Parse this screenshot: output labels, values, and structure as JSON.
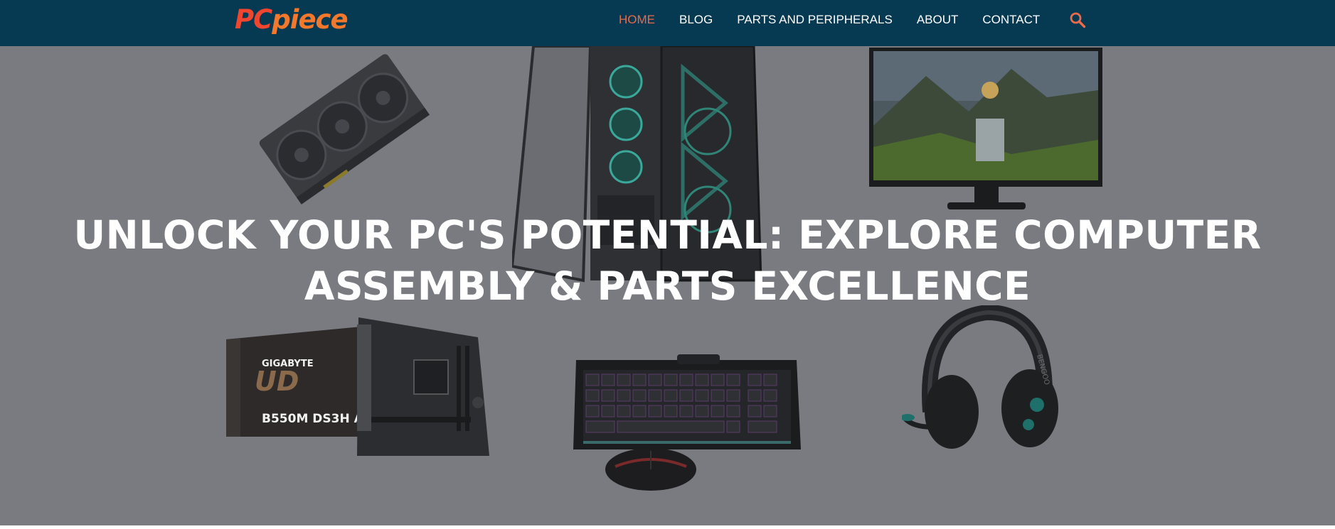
{
  "brand": {
    "logo_pc": "PC",
    "logo_piece": "piece",
    "logo_pc_color": "#f0452f",
    "logo_piece_color": "#f3782c"
  },
  "nav": {
    "items": [
      {
        "label": "HOME",
        "active": true
      },
      {
        "label": "BLOG",
        "active": false
      },
      {
        "label": "PARTS AND PERIPHERALS",
        "active": false
      },
      {
        "label": "ABOUT",
        "active": false
      },
      {
        "label": "CONTACT",
        "active": false
      }
    ],
    "search_icon": "search-icon",
    "background": "#063952",
    "active_color": "#ea6a4a"
  },
  "hero": {
    "title": "UNLOCK YOUR PC'S POTENTIAL: EXPLORE COMPUTER ASSEMBLY & PARTS EXCELLENCE",
    "overlay_color": "#7a7b80",
    "motherboard_brand": "GIGABYTE",
    "motherboard_model": "B550M DS3H AC",
    "headset_brand": "BENGOO",
    "products": [
      "graphics-card",
      "pc-case",
      "monitor",
      "motherboard",
      "keyboard",
      "mouse",
      "headset"
    ]
  }
}
